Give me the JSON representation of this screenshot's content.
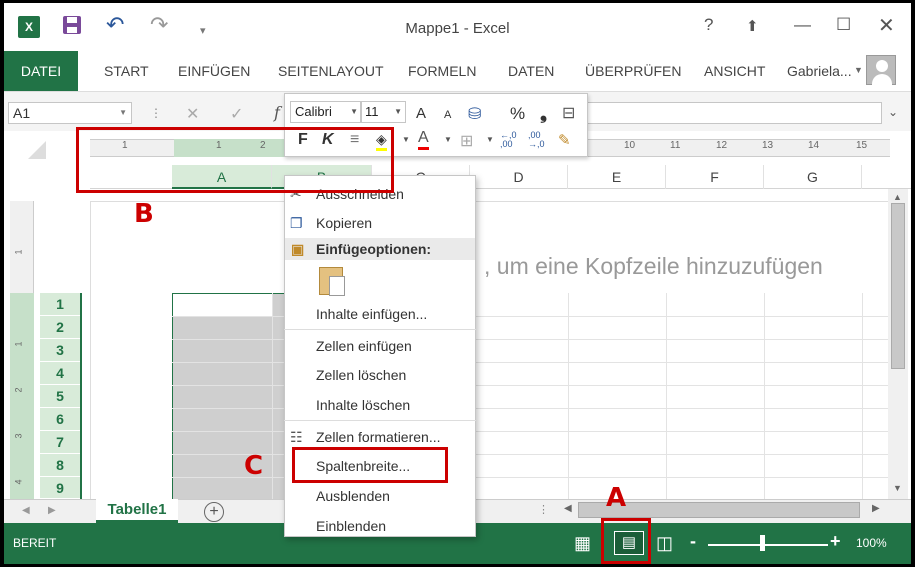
{
  "titlebar": {
    "title": "Mappe1 - Excel",
    "excel_logo_text": "X",
    "help": "?",
    "minimize": "—",
    "maximize": "☐",
    "close": "✕"
  },
  "ribbon": {
    "tabs": [
      "DATEI",
      "START",
      "EINFÜGEN",
      "SEITENLAYOUT",
      "FORMELN",
      "DATEN",
      "ÜBERPRÜFEN",
      "ANSICHT"
    ],
    "active_tab": "DATEI",
    "user": "Gabriela..."
  },
  "formula_bar": {
    "name_box": "A1",
    "fx_label": "f",
    "formula_value": ""
  },
  "ruler": {
    "ticks": [
      "1",
      "1",
      "2",
      "10",
      "11",
      "12",
      "13",
      "14",
      "15"
    ]
  },
  "columns": [
    "A",
    "B",
    "C",
    "D",
    "E",
    "F",
    "G"
  ],
  "rows": [
    "1",
    "2",
    "3",
    "4",
    "5",
    "6",
    "7",
    "8",
    "9"
  ],
  "left_ruler_ticks": [
    "1",
    "1",
    "2",
    "3",
    "4"
  ],
  "sheet": {
    "header_placeholder": ", um eine Kopfzeile hinzuzufügen"
  },
  "sheet_tabs": {
    "active": "Tabelle1",
    "add": "+"
  },
  "status_bar": {
    "status": "BEREIT",
    "zoom": "100%",
    "zoom_fraction": 0.45
  },
  "mini_toolbar": {
    "font_name": "Calibri",
    "font_size": "11",
    "bold": "F",
    "italic": "K",
    "font_grow": "A",
    "font_shrink": "A",
    "percent": "%",
    "comma": "❟",
    "font_color": "A",
    "increase_decimal": "←,0 ,00",
    "decrease_decimal": ",00 →,0"
  },
  "context_menu": {
    "items": [
      {
        "label": "Ausschneiden",
        "icon": "scissors-icon"
      },
      {
        "label": "Kopieren",
        "icon": "copy-icon"
      },
      {
        "label": "Einfügeoptionen:",
        "icon": "paste-icon"
      },
      {
        "label": "Inhalte einfügen...",
        "icon": ""
      },
      {
        "label": "Zellen einfügen",
        "icon": ""
      },
      {
        "label": "Zellen löschen",
        "icon": ""
      },
      {
        "label": "Inhalte löschen",
        "icon": ""
      },
      {
        "label": "Zellen formatieren...",
        "icon": "format-cells-icon"
      },
      {
        "label": "Spaltenbreite...",
        "icon": ""
      },
      {
        "label": "Ausblenden",
        "icon": ""
      },
      {
        "label": "Einblenden",
        "icon": ""
      }
    ]
  },
  "annotations": {
    "a": "A",
    "b": "B",
    "c": "C"
  },
  "colors": {
    "excel_green": "#217346",
    "annotation_red": "#cc0000"
  }
}
